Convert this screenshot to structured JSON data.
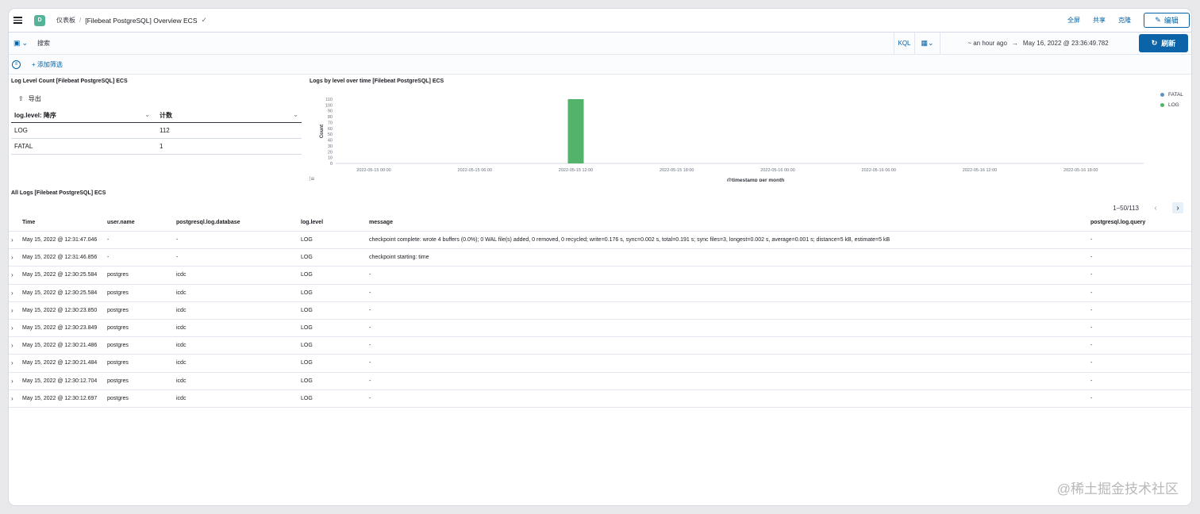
{
  "header": {
    "space_initial": "D",
    "breadcrumb_root": "仪表板",
    "breadcrumb_current": "[Filebeat PostgreSQL] Overview ECS",
    "actions": {
      "fullscreen": "全屏",
      "share": "共享",
      "clone": "克隆",
      "edit": "编辑"
    }
  },
  "query": {
    "search_placeholder": "搜索",
    "language": "KQL",
    "date_start": "~ an hour ago",
    "arrow": "→",
    "date_end": "May 16, 2022 @ 23:36:49.782",
    "refresh": "刷新",
    "add_filter": "+ 添加筛选"
  },
  "level_count_panel": {
    "title": "Log Level Count [Filebeat PostgreSQL] ECS",
    "export": "导出",
    "col1": "log.level: 降序",
    "col2": "计数",
    "rows": [
      {
        "level": "LOG",
        "count": "112"
      },
      {
        "level": "FATAL",
        "count": "1"
      }
    ]
  },
  "chart_panel": {
    "title": "Logs by level over time [Filebeat PostgreSQL] ECS"
  },
  "chart_data": {
    "type": "bar",
    "title": "Logs by level over time [Filebeat PostgreSQL] ECS",
    "xlabel": "@timestamp per month",
    "ylabel": "Count",
    "ylim": [
      0,
      110
    ],
    "yticks": [
      "0",
      "10",
      "20",
      "30",
      "40",
      "50",
      "60",
      "70",
      "80",
      "90",
      "100",
      "110"
    ],
    "xticks": [
      "2022-05-15 00:00",
      "2022-05-15 06:00",
      "2022-05-15 12:00",
      "2022-05-15 18:00",
      "2022-05-16 00:00",
      "2022-05-16 06:00",
      "2022-05-16 12:00",
      "2022-05-16 18:00"
    ],
    "series": [
      {
        "name": "FATAL",
        "color": "#6092c0",
        "points": []
      },
      {
        "name": "LOG",
        "color": "#54b36b",
        "points": [
          {
            "x": "2022-05-15 12:00",
            "y": 112
          }
        ]
      }
    ],
    "legend": "top-right"
  },
  "logs_panel": {
    "title": "All Logs [Filebeat PostgreSQL] ECS",
    "pagination": "1–50/113",
    "columns": [
      "Time",
      "user.name",
      "postgresql.log.database",
      "log.level",
      "message",
      "postgresql.log.query"
    ],
    "rows": [
      {
        "time": "May 15, 2022 @ 12:31:47.046",
        "user": "-",
        "db": "-",
        "level": "LOG",
        "message": "checkpoint complete: wrote 4 buffers (0.0%); 0 WAL file(s) added, 0 removed, 0 recycled; write=0.176 s, sync=0.002 s, total=0.191 s; sync files=3, longest=0.002 s, average=0.001 s; distance=5 kB, estimate=5 kB",
        "query": "-"
      },
      {
        "time": "May 15, 2022 @ 12:31:46.856",
        "user": "-",
        "db": "-",
        "level": "LOG",
        "message": "checkpoint starting: time",
        "query": "-"
      },
      {
        "time": "May 15, 2022 @ 12:30:25.584",
        "user": "postgres",
        "db": "icdc",
        "level": "LOG",
        "message": "-",
        "query": "-"
      },
      {
        "time": "May 15, 2022 @ 12:30:25.584",
        "user": "postgres",
        "db": "icdc",
        "level": "LOG",
        "message": "-",
        "query": "-"
      },
      {
        "time": "May 15, 2022 @ 12:30:23.850",
        "user": "postgres",
        "db": "icdc",
        "level": "LOG",
        "message": "-",
        "query": "-"
      },
      {
        "time": "May 15, 2022 @ 12:30:23.849",
        "user": "postgres",
        "db": "icdc",
        "level": "LOG",
        "message": "-",
        "query": "-"
      },
      {
        "time": "May 15, 2022 @ 12:30:21.486",
        "user": "postgres",
        "db": "icdc",
        "level": "LOG",
        "message": "-",
        "query": "-"
      },
      {
        "time": "May 15, 2022 @ 12:30:21.484",
        "user": "postgres",
        "db": "icdc",
        "level": "LOG",
        "message": "-",
        "query": "-"
      },
      {
        "time": "May 15, 2022 @ 12:30:12.704",
        "user": "postgres",
        "db": "icdc",
        "level": "LOG",
        "message": "-",
        "query": "-"
      },
      {
        "time": "May 15, 2022 @ 12:30:12.697",
        "user": "postgres",
        "db": "icdc",
        "level": "LOG",
        "message": "-",
        "query": "-"
      }
    ]
  },
  "watermark": "@稀土掘金技术社区"
}
